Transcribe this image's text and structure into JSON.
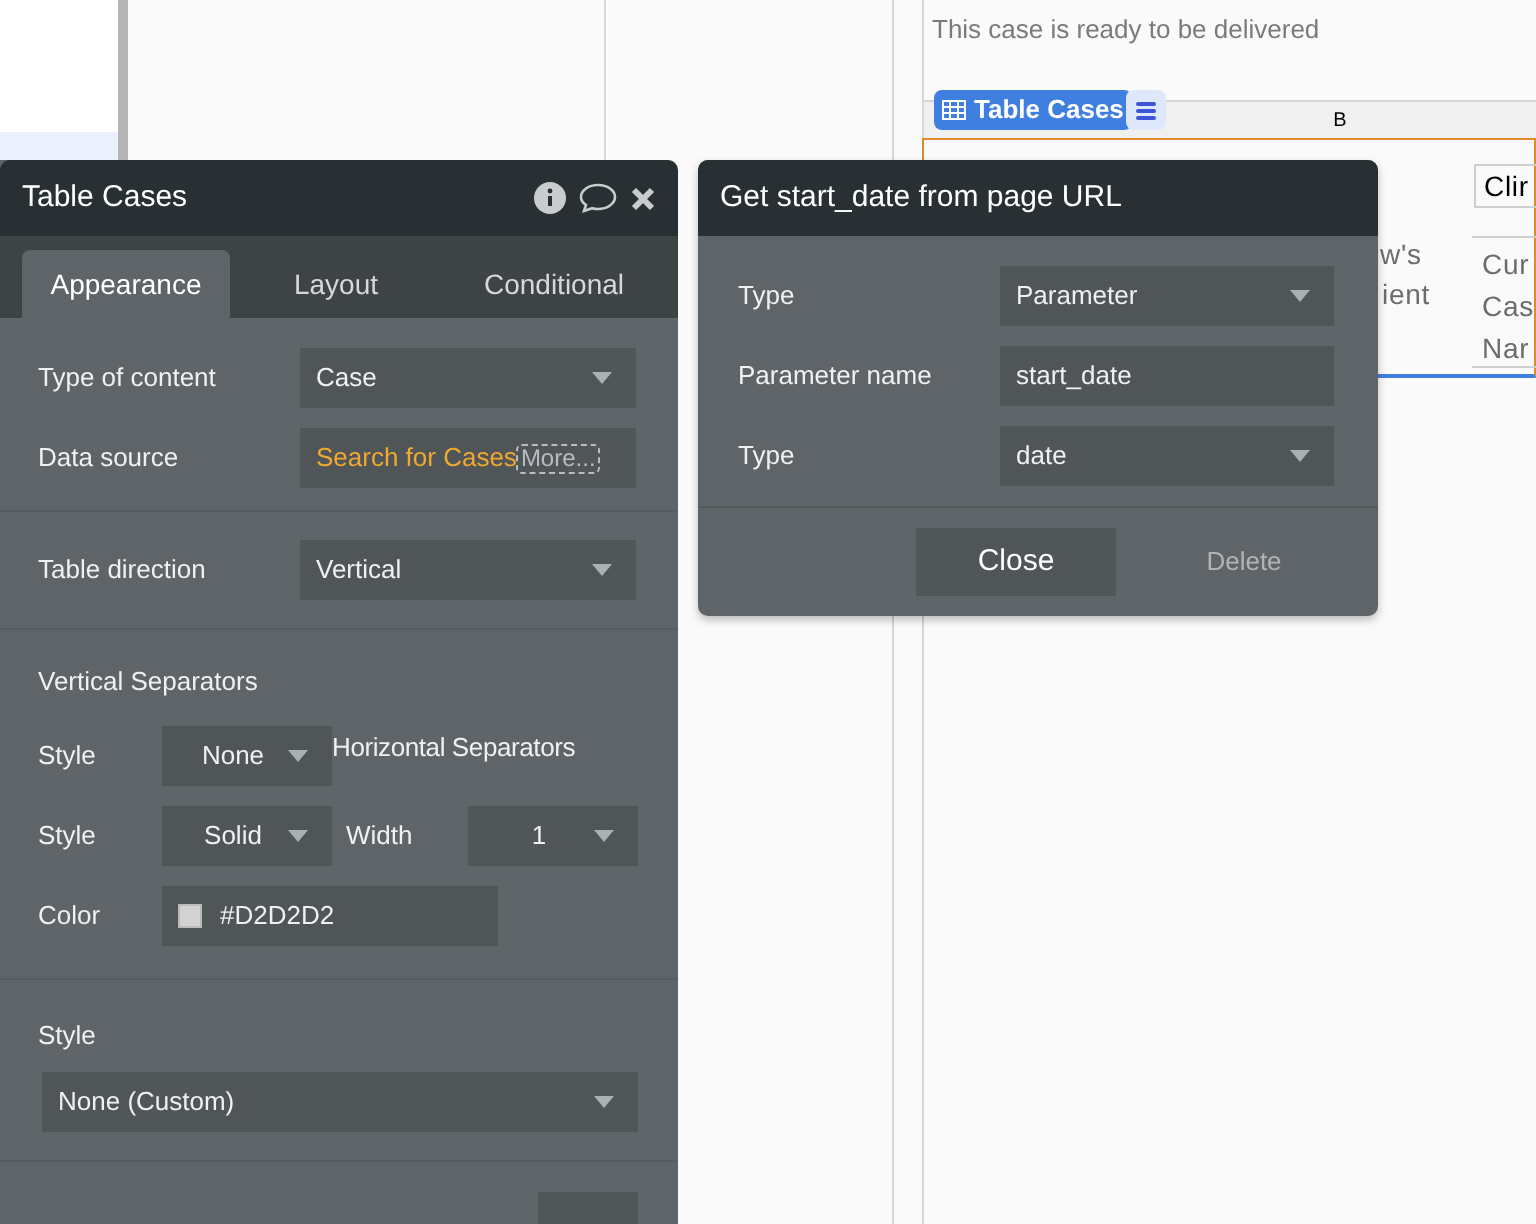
{
  "canvas": {
    "message": "This case is ready to be delivered",
    "element_badge": "Table Cases",
    "column_label": "B",
    "cells": [
      {
        "text": "Clir",
        "kind": "boxed"
      },
      {
        "text": "w's",
        "kind": "plain"
      },
      {
        "text": "Cur",
        "kind": "plain"
      },
      {
        "text": "ient",
        "kind": "plain"
      },
      {
        "text": "Cas",
        "kind": "plain"
      },
      {
        "text": "Nar",
        "kind": "plain"
      }
    ]
  },
  "property_editor": {
    "title": "Table Cases",
    "tabs": [
      {
        "label": "Appearance",
        "selected": true
      },
      {
        "label": "Layout",
        "selected": false
      },
      {
        "label": "Conditional",
        "selected": false
      }
    ],
    "type_of_content": {
      "label": "Type of content",
      "value": "Case"
    },
    "data_source": {
      "label": "Data source",
      "value": "Search for Cases",
      "more": "More..."
    },
    "table_direction": {
      "label": "Table direction",
      "value": "Vertical"
    },
    "vertical_separators": {
      "heading": "Vertical Separators",
      "style_label": "Style",
      "style_value": "None"
    },
    "horizontal_separators": {
      "heading": "Horizontal Separators",
      "style_label": "Style",
      "style_value": "Solid",
      "width_label": "Width",
      "width_value": "1",
      "color_label": "Color",
      "color_value": "#D2D2D2",
      "color": "#d2d2d2"
    },
    "style": {
      "label": "Style",
      "value": "None (Custom)"
    }
  },
  "url_dialog": {
    "title": "Get start_date from page URL",
    "rows": [
      {
        "label": "Type",
        "value": "Parameter",
        "kind": "dropdown"
      },
      {
        "label": "Parameter name",
        "value": "start_date",
        "kind": "text"
      },
      {
        "label": "Type",
        "value": "date",
        "kind": "dropdown"
      }
    ],
    "buttons": [
      {
        "label": "Close",
        "kind": "primary"
      },
      {
        "label": "Delete",
        "kind": "secondary"
      }
    ]
  }
}
